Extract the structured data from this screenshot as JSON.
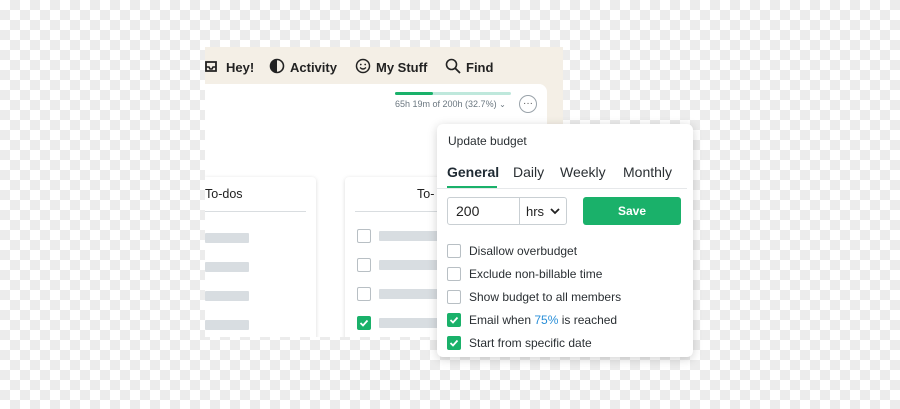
{
  "nav": {
    "items": [
      {
        "label": "Hey!",
        "icon": "inbox-icon"
      },
      {
        "label": "Activity",
        "icon": "activity-icon"
      },
      {
        "label": "My Stuff",
        "icon": "smiley-icon"
      },
      {
        "label": "Find",
        "icon": "search-icon"
      }
    ]
  },
  "budget": {
    "progress_label": "65h 19m of 200h (32.7%)",
    "progress_fraction": 0.327,
    "more_label": "···"
  },
  "todos": {
    "left_title": "To-dos",
    "right_title": "To-",
    "right_items": [
      {
        "checked": false
      },
      {
        "checked": false
      },
      {
        "checked": false
      },
      {
        "checked": true
      },
      {
        "checked": true
      }
    ]
  },
  "popover": {
    "title": "Update budget",
    "tabs": [
      {
        "label": "General",
        "active": true
      },
      {
        "label": "Daily",
        "active": false
      },
      {
        "label": "Weekly",
        "active": false
      },
      {
        "label": "Monthly",
        "active": false
      }
    ],
    "hours_value": "200",
    "unit_value": "hrs",
    "save_label": "Save",
    "options": [
      {
        "label": "Disallow overbudget",
        "checked": false
      },
      {
        "label": "Exclude non-billable time",
        "checked": false
      },
      {
        "label": "Show budget to all members",
        "checked": false
      },
      {
        "label_prefix": "Email when ",
        "label_accent": "75%",
        "label_suffix": " is reached",
        "checked": true
      },
      {
        "label": "Start from specific date",
        "checked": true
      }
    ]
  },
  "colors": {
    "accent_green": "#1ab16a",
    "link_blue": "#2a8fd8",
    "window_bg": "#f4efe6"
  }
}
